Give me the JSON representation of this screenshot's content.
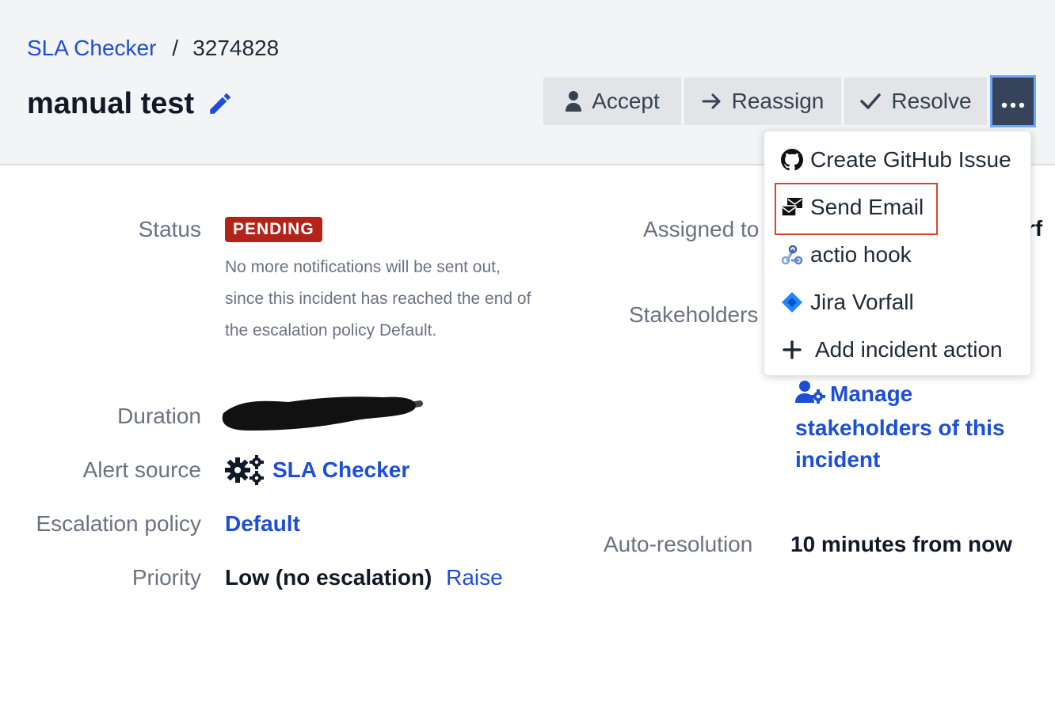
{
  "breadcrumb": {
    "parent": "SLA Checker",
    "separator": "/",
    "current": "3274828"
  },
  "incident": {
    "title": "manual test"
  },
  "actions": {
    "accept": "Accept",
    "reassign": "Reassign",
    "resolve": "Resolve"
  },
  "menu": {
    "items": [
      {
        "label": "Create GitHub Issue",
        "icon": "github-icon"
      },
      {
        "label": "Send Email",
        "icon": "email-icon"
      },
      {
        "label": "actio hook",
        "icon": "webhook-icon"
      },
      {
        "label": "Jira Vorfall",
        "icon": "jira-icon"
      },
      {
        "label": "Add incident action",
        "icon": "plus-icon"
      }
    ],
    "highlighted": "Send Email"
  },
  "details": {
    "status_label": "Status",
    "status_badge": "PENDING",
    "status_description": "No more notifications will be sent out, since this incident has reached the end of the escalation policy Default.",
    "duration_label": "Duration",
    "alert_source_label": "Alert source",
    "alert_source_value": "SLA Checker",
    "escalation_label": "Escalation policy",
    "escalation_value": "Default",
    "priority_label": "Priority",
    "priority_value": "Low (no escalation)",
    "priority_action": "Raise"
  },
  "side": {
    "assigned_label": "Assigned to",
    "assigned_value_fragment": "rf",
    "stakeholders_label": "Stakeholders",
    "manage_link": "Manage stakeholders of this incident",
    "auto_resolution_label": "Auto-resolution",
    "auto_resolution_value": "10 minutes from now"
  },
  "colors": {
    "link": "#1d4ed8",
    "badge": "#b42318",
    "more_button": "#36435b",
    "highlight": "#d9442c"
  }
}
